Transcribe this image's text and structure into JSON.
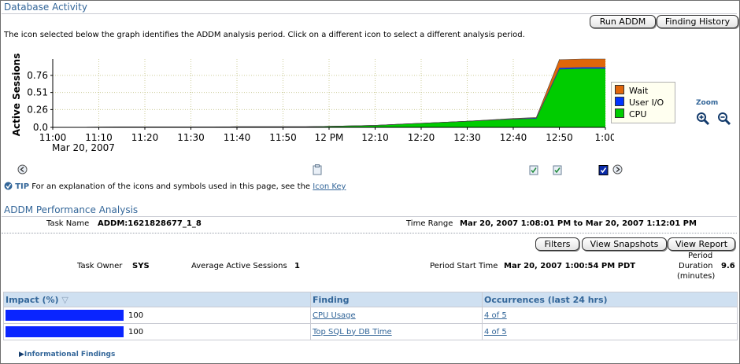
{
  "header": {
    "title": "Database Activity",
    "instructions": "The icon selected below the graph identifies the ADDM analysis period. Click on a different icon to select a different analysis period.",
    "buttons": {
      "run_addm": "Run ADDM",
      "finding_history": "Finding History"
    }
  },
  "chart_data": {
    "type": "area",
    "ylabel": "Active Sessions",
    "x_ticks": [
      "11:00",
      "11:10",
      "11:20",
      "11:30",
      "11:40",
      "11:50",
      "12 PM",
      "12:10",
      "12:20",
      "12:30",
      "12:40",
      "12:50",
      "1:00"
    ],
    "x_sublabel": "Mar 20, 2007",
    "y_ticks": [
      "0.0",
      "0.26",
      "0.51",
      "0.76"
    ],
    "ylim": [
      0,
      1.0
    ],
    "x_minutes": [
      0,
      15,
      20,
      25,
      30,
      35,
      40,
      45,
      50,
      55,
      60,
      70,
      80,
      90,
      100,
      105,
      110,
      115,
      120
    ],
    "series": [
      {
        "name": "CPU",
        "color": "#00cc00",
        "values": [
          0,
          0.005,
          0.005,
          0.005,
          0.005,
          0.005,
          0.01,
          0.01,
          0.01,
          0.01,
          0.015,
          0.03,
          0.06,
          0.09,
          0.12,
          0.13,
          0.85,
          0.86,
          0.86
        ]
      },
      {
        "name": "User I/O",
        "color": "#0033ff",
        "values": [
          0,
          0,
          0,
          0,
          0,
          0,
          0,
          0,
          0,
          0,
          0,
          0,
          0,
          0,
          0.005,
          0.01,
          0.02,
          0.02,
          0.02
        ]
      },
      {
        "name": "Wait",
        "color": "#e0660a",
        "values": [
          0,
          0,
          0,
          0,
          0,
          0,
          0,
          0,
          0,
          0,
          0,
          0,
          0,
          0,
          0.005,
          0.005,
          0.12,
          0.12,
          0.12
        ]
      }
    ],
    "legend": [
      "Wait",
      "User I/O",
      "CPU"
    ],
    "legend_position": "right",
    "grid": true
  },
  "zoom": {
    "label": "Zoom",
    "zoom_in_icon": "zoom-in-icon",
    "zoom_out_icon": "zoom-out-icon"
  },
  "tip": {
    "label": "TIP",
    "text": "For an explanation of the icons and symbols used in this page, see the",
    "link": "Icon Key"
  },
  "addm": {
    "title": "ADDM Performance Analysis",
    "task_name_label": "Task Name",
    "task_name": "ADDM:1621828677_1_8",
    "time_range_label": "Time Range",
    "time_range": "Mar 20, 2007 1:08:01 PM to Mar 20, 2007 1:12:01 PM",
    "buttons": {
      "filters": "Filters",
      "view_snapshots": "View Snapshots",
      "view_report": "View Report"
    },
    "task_owner_label": "Task Owner",
    "task_owner": "SYS",
    "avg_sessions_label": "Average Active Sessions",
    "avg_sessions": "1",
    "period_start_label": "Period Start Time",
    "period_start": "Mar 20, 2007 1:00:54 PM PDT",
    "period_duration_label_1": "Period",
    "period_duration_label_2": "Duration",
    "period_duration_label_3": "(minutes)",
    "period_duration": "9.6"
  },
  "findings_table": {
    "columns": [
      "Impact (%)",
      "Finding",
      "Occurrences (last 24 hrs)"
    ],
    "rows": [
      {
        "impact": "100",
        "impact_fraction": 1.0,
        "finding": "CPU Usage",
        "occurrences": "4 of 5"
      },
      {
        "impact": "100",
        "impact_fraction": 1.0,
        "finding": "Top SQL by DB Time",
        "occurrences": "4 of 5"
      }
    ]
  },
  "informational": {
    "label": "Informational Findings"
  },
  "colors": {
    "accent": "#336699",
    "header_bg": "#cfe0f1",
    "impact_bar": "#0a25ff"
  }
}
